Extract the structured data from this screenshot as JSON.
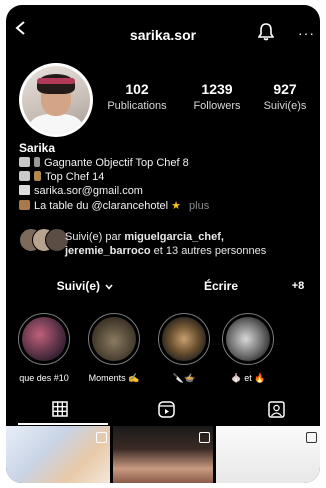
{
  "header": {
    "username": "sarika.sor"
  },
  "stats": [
    {
      "value": "102",
      "label": "Publications"
    },
    {
      "value": "1239",
      "label": "Followers"
    },
    {
      "value": "927",
      "label": "Suivi(e)s"
    }
  ],
  "bio": {
    "name": "Sarika",
    "lines": [
      "Gagnante Objectif Top Chef 8",
      "Top Chef 14",
      "sarika.sor@gmail.com",
      "La table du @clarancehotel"
    ],
    "more_label": "plus"
  },
  "followed_by": {
    "prefix": "Suivi(e) par",
    "user1": "miguelgarcia_chef,",
    "user2": "jeremie_barroco",
    "suffix": "et 13 autres personnes"
  },
  "actions": {
    "follow_label": "Suivi(e)",
    "write_label": "Écrire",
    "add_label": "+8"
  },
  "highlights": [
    {
      "label": "que des #10"
    },
    {
      "label": "Moments"
    },
    {
      "label": ""
    },
    {
      "label": "et"
    }
  ],
  "colors": {
    "background": "#000000",
    "text": "#ffffff",
    "muted": "#8a8a8a"
  },
  "icons": {
    "back": "chevron-left-icon",
    "bell": "bell-icon",
    "more": "more-icon",
    "grid": "grid-icon",
    "reels": "reels-icon",
    "tagged": "tagged-icon"
  }
}
